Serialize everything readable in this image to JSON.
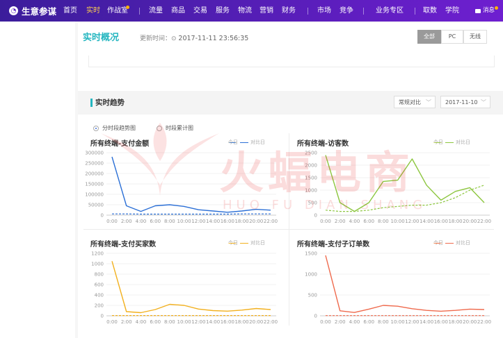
{
  "topbar": {
    "brand": "生意参谋",
    "nav": [
      "首页",
      "实时",
      "作战室",
      "流量",
      "商品",
      "交易",
      "服务",
      "物流",
      "营销",
      "财务",
      "市场",
      "竞争",
      "业务专区",
      "取数",
      "学院"
    ],
    "active": "实时",
    "message": "消息"
  },
  "overview": {
    "title": "实时概况",
    "updated_label": "更新时间：",
    "updated_time": "2017-11-11 23:56:35",
    "segments": [
      "全部",
      "PC",
      "无线"
    ],
    "active_segment": "全部"
  },
  "trend": {
    "title": "实时趋势",
    "compare_select": "常规对比",
    "date_select": "2017-11-10",
    "radio_options": [
      "分时段趋势图",
      "时段累计图"
    ],
    "radio_selected": "分时段趋势图"
  },
  "legend_labels": {
    "today": "今日",
    "compare": "对比日"
  },
  "watermark": {
    "main": "火蝠电商",
    "sub": "HUO FU DIAN SHANG"
  },
  "colors": {
    "accent": "#24b6c0",
    "nav_active": "#ffd24d"
  },
  "chart_data": [
    {
      "type": "line",
      "title": "所有终端-支付金额",
      "x": [
        "0:00",
        "2:00",
        "4:00",
        "6:00",
        "8:00",
        "10:00",
        "12:00",
        "14:00",
        "16:00",
        "18:00",
        "20:00",
        "22:00"
      ],
      "ylim": [
        0,
        300000
      ],
      "yticks": [
        "300000",
        "250000",
        "200000",
        "150000",
        "100000",
        "50000",
        "0"
      ],
      "series": [
        {
          "name": "今日",
          "color": "#2b6fd6",
          "dashed": false,
          "values": [
            280000,
            45000,
            18000,
            45000,
            50000,
            42000,
            26000,
            20000,
            14000,
            20000,
            28000,
            24000
          ]
        },
        {
          "name": "对比日",
          "color": "#2b6fd6",
          "dashed": true,
          "values": [
            6000,
            6000,
            5000,
            5000,
            5000,
            5000,
            5000,
            5000,
            5000,
            6000,
            6000,
            6000
          ]
        }
      ]
    },
    {
      "type": "line",
      "title": "所有终端-访客数",
      "x": [
        "0:00",
        "2:00",
        "4:00",
        "6:00",
        "8:00",
        "10:00",
        "12:00",
        "14:00",
        "16:00",
        "18:00",
        "20:00",
        "22:00"
      ],
      "ylim": [
        0,
        2500
      ],
      "yticks": [
        "2500",
        "2000",
        "1500",
        "1000",
        "500",
        "0"
      ],
      "series": [
        {
          "name": "今日",
          "color": "#8cc63e",
          "dashed": false,
          "values": [
            2400,
            500,
            150,
            500,
            1350,
            1400,
            2250,
            1200,
            600,
            950,
            1100,
            500
          ]
        },
        {
          "name": "对比日",
          "color": "#8cc63e",
          "dashed": true,
          "values": [
            200,
            150,
            150,
            200,
            300,
            350,
            400,
            400,
            500,
            700,
            1000,
            1200
          ]
        }
      ]
    },
    {
      "type": "line",
      "title": "所有终端-支付买家数",
      "x": [
        "0:00",
        "2:00",
        "4:00",
        "6:00",
        "8:00",
        "10:00",
        "12:00",
        "14:00",
        "16:00",
        "18:00",
        "20:00",
        "22:00"
      ],
      "ylim": [
        0,
        1200
      ],
      "yticks": [
        "1200",
        "1000",
        "800",
        "600",
        "400",
        "200",
        "0"
      ],
      "series": [
        {
          "name": "今日",
          "color": "#f2b01e",
          "dashed": false,
          "values": [
            1050,
            80,
            60,
            120,
            220,
            200,
            130,
            100,
            90,
            110,
            140,
            120
          ]
        },
        {
          "name": "对比日",
          "color": "#f2b01e",
          "dashed": true,
          "values": [
            5,
            5,
            5,
            5,
            5,
            5,
            5,
            5,
            5,
            5,
            5,
            5
          ]
        }
      ]
    },
    {
      "type": "line",
      "title": "所有终端-支付子订单数",
      "x": [
        "0:00",
        "2:00",
        "4:00",
        "6:00",
        "8:00",
        "10:00",
        "12:00",
        "14:00",
        "16:00",
        "18:00",
        "20:00",
        "22:00"
      ],
      "ylim": [
        0,
        1500
      ],
      "yticks": [
        "1500",
        "1000",
        "500",
        "0"
      ],
      "series": [
        {
          "name": "今日",
          "color": "#ef6a4d",
          "dashed": false,
          "values": [
            1450,
            120,
            80,
            160,
            250,
            230,
            170,
            130,
            110,
            130,
            160,
            150
          ]
        },
        {
          "name": "对比日",
          "color": "#ef6a4d",
          "dashed": true,
          "values": [
            5,
            5,
            5,
            5,
            5,
            5,
            5,
            5,
            5,
            5,
            5,
            5
          ]
        }
      ]
    }
  ]
}
